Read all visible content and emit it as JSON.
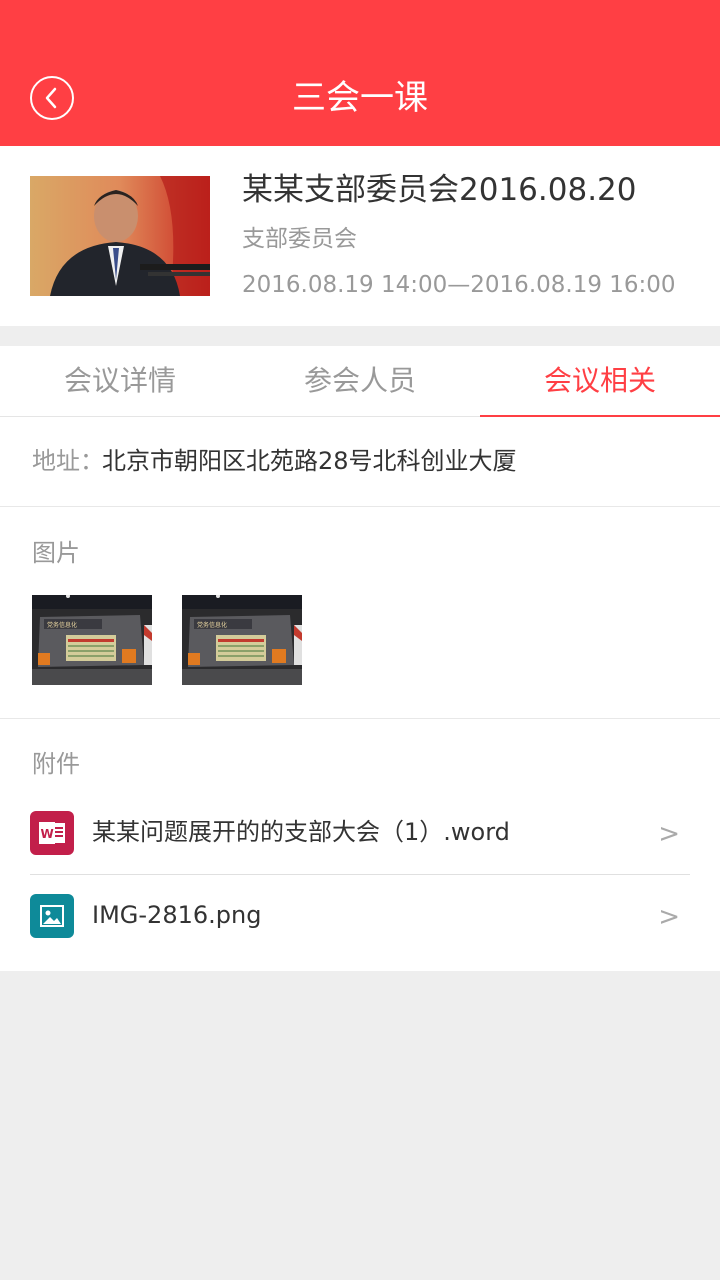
{
  "header": {
    "title": "三会一课",
    "back_icon": "back-arrow-icon"
  },
  "meeting": {
    "title": "某某支部委员会2016.08.20",
    "type": "支部委员会",
    "time": "2016.08.19 14:00—2016.08.19 16:00"
  },
  "tabs": [
    {
      "label": "会议详情",
      "active": false
    },
    {
      "label": "参会人员",
      "active": false
    },
    {
      "label": "会议相关",
      "active": true
    }
  ],
  "address": {
    "label": "地址：",
    "value": "北京市朝阳区北苑路28号北科创业大厦"
  },
  "images": {
    "label": "图片",
    "count": 2
  },
  "attachments": {
    "label": "附件",
    "files": [
      {
        "name": "某某问题展开的的支部大会（1）.word",
        "icon": "word-file-icon",
        "color": "#c21f4a"
      },
      {
        "name": "IMG-2816.png",
        "icon": "image-file-icon",
        "color": "#0e8a99"
      }
    ],
    "chevron": ">"
  },
  "colors": {
    "accent": "#ff3f44",
    "background": "#eeeeee"
  }
}
